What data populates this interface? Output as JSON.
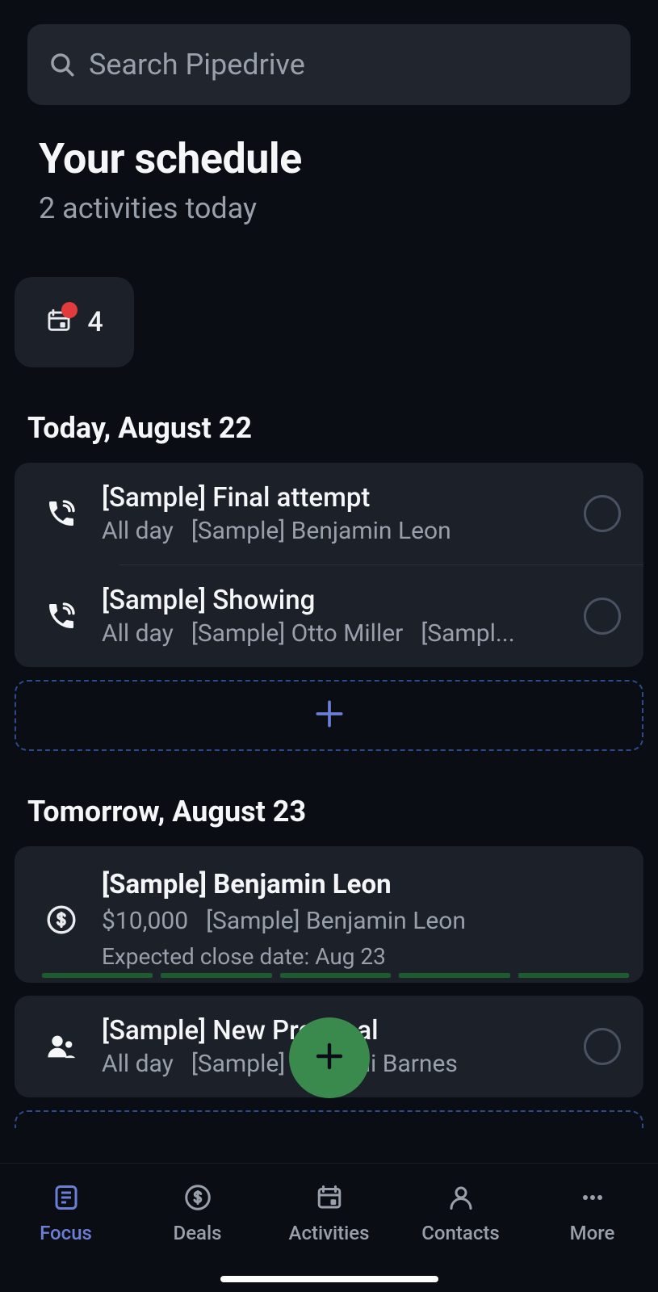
{
  "search": {
    "placeholder": "Search Pipedrive"
  },
  "header": {
    "title": "Your schedule",
    "subtitle": "2 activities today"
  },
  "overdue": {
    "count": "4"
  },
  "sections": {
    "today": {
      "label": "Today, August 22",
      "items": [
        {
          "title": "[Sample] Final attempt",
          "time": "All day",
          "contact": "[Sample] Benjamin Leon"
        },
        {
          "title": "[Sample] Showing",
          "time": "All day",
          "contact": "[Sample] Otto Miller",
          "extra": "[Sampl..."
        }
      ]
    },
    "tomorrow": {
      "label": "Tomorrow, August 23",
      "deal": {
        "title": "[Sample] Benjamin Leon",
        "value": "$10,000",
        "person": "[Sample] Benjamin Leon",
        "close": "Expected close date: Aug 23"
      },
      "items": [
        {
          "title": "[Sample] New Proposal",
          "time": "All day",
          "contact": "[Sample] Malachi Barnes"
        }
      ]
    }
  },
  "tabs": {
    "focus": "Focus",
    "deals": "Deals",
    "activities": "Activities",
    "contacts": "Contacts",
    "more": "More"
  },
  "colors": {
    "accent": "#6b7fd6",
    "fab": "#3a8a4d"
  }
}
